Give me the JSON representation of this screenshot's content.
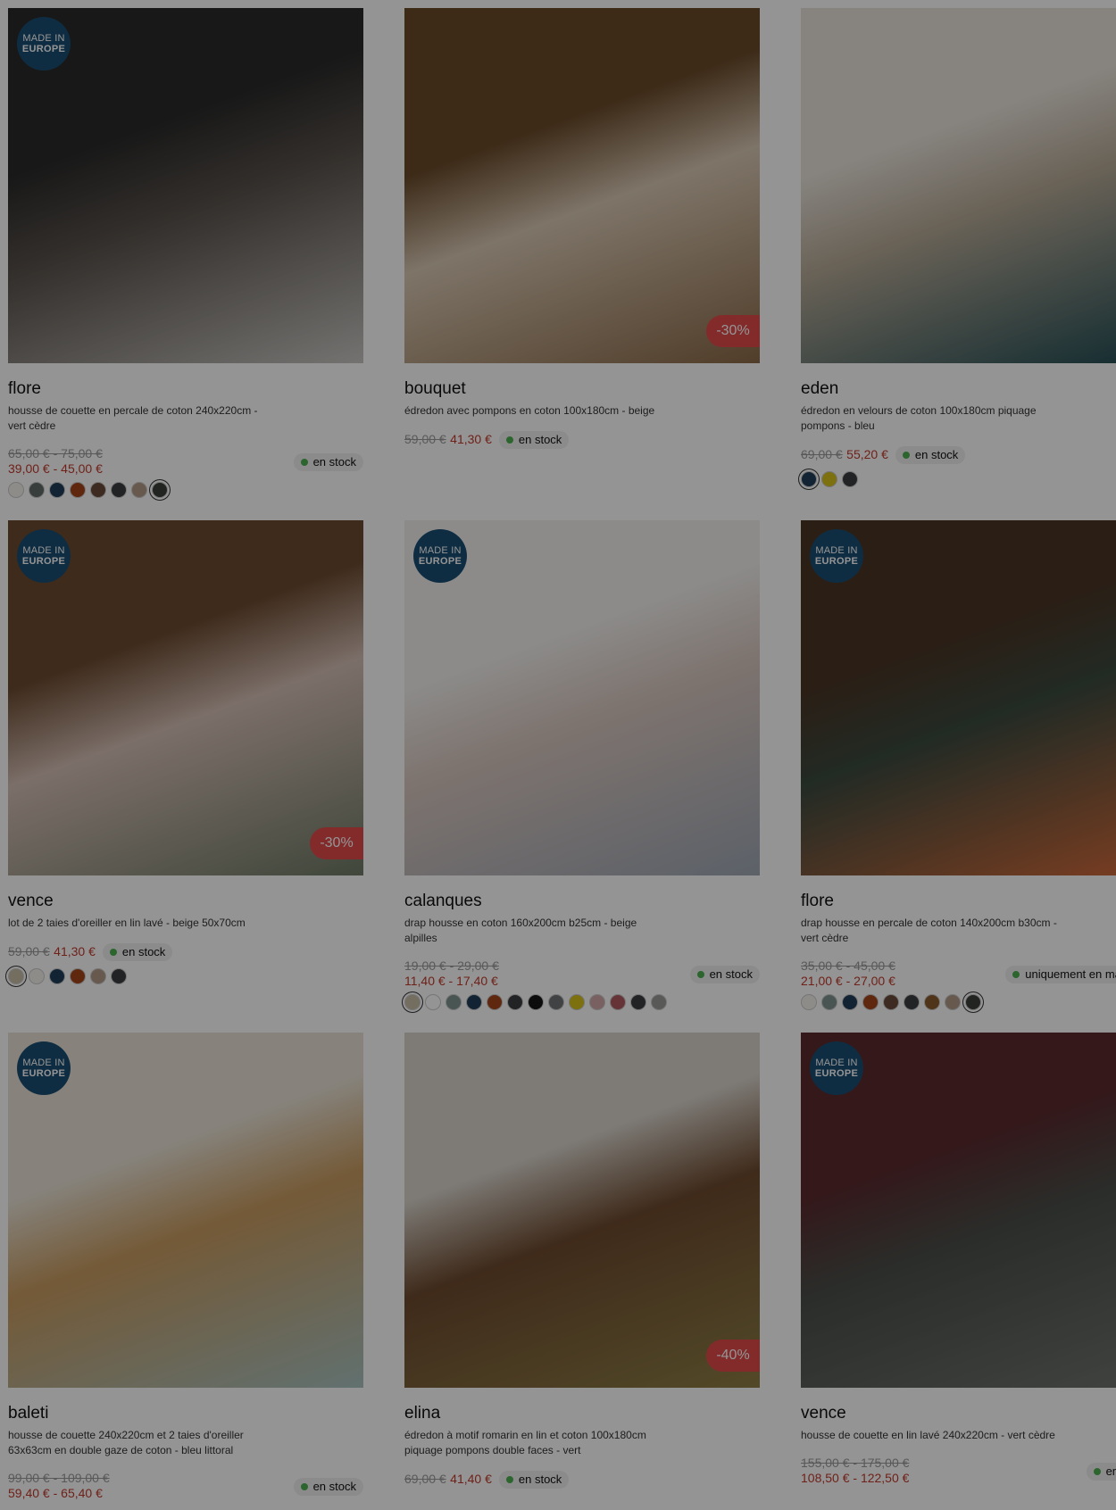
{
  "badge": {
    "line1": "MADE IN",
    "line2": "EUROPE"
  },
  "products": [
    {
      "name": "flore",
      "desc": "housse de couette en percale de coton 240x220cm - vert cèdre",
      "old": "65,00 € - 75,00 €",
      "new": "39,00 € - 45,00 €",
      "stock": "en stock",
      "made_eu": true,
      "discount": "",
      "swatches": [
        "#f4f1ea",
        "#5f6b66",
        "#1f3d5a",
        "#a5441b",
        "#6a4a3a",
        "#3b3d40",
        "#b29986",
        "#3a3f3a"
      ]
    },
    {
      "name": "bouquet",
      "desc": "édredon avec pompons en coton 100x180cm - beige",
      "old": "59,00 €",
      "new": "41,30 €",
      "stock": "en stock",
      "made_eu": false,
      "discount": "-30%",
      "swatches": []
    },
    {
      "name": "eden",
      "desc": "édredon en velours de coton 100x180cm piquage pompons - bleu",
      "old": "69,00 €",
      "new": "55,20 €",
      "stock": "en stock",
      "made_eu": false,
      "discount": "",
      "swatches": [
        "#1f3d5a",
        "#d6c11b",
        "#3b3d40"
      ]
    },
    {
      "name": "vence",
      "desc": "lot de 2 taies d'oreiller en lin lavé - beige 50x70cm",
      "old": "59,00 €",
      "new": "41,30 €",
      "stock": "en stock",
      "made_eu": true,
      "discount": "-30%",
      "swatches": [
        "#c9bda6",
        "#f4f1ea",
        "#1f3d5a",
        "#a5441b",
        "#b29986",
        "#3b3d40"
      ]
    },
    {
      "name": "calanques",
      "desc": "drap housse en coton 160x200cm b25cm - beige alpilles",
      "old": "19,00 € - 29,00 €",
      "new": "11,40 € - 17,40 €",
      "stock": "en stock",
      "made_eu": true,
      "discount": "",
      "swatches": [
        "#c9bda6",
        "#ffffff",
        "#7f938f",
        "#1f3d5a",
        "#a5441b",
        "#3b3d40",
        "#151515",
        "#6f7275",
        "#d6c11b",
        "#d3a7a7",
        "#b05a5f",
        "#3b3d40",
        "#9a9a98"
      ]
    },
    {
      "name": "flore",
      "desc": "drap housse en percale de coton 140x200cm b30cm - vert cèdre",
      "old": "35,00 € - 45,00 €",
      "new": "21,00 € - 27,00 €",
      "stock": "uniquement en magasin",
      "made_eu": true,
      "discount": "",
      "swatches": [
        "#f4f1ea",
        "#7f938f",
        "#1f3d5a",
        "#a5441b",
        "#6a4a3a",
        "#3b3d40",
        "#8a5a2b",
        "#b29986",
        "#3a3f3a"
      ]
    },
    {
      "name": "baleti",
      "desc": "housse de couette 240x220cm et 2 taies d'oreiller 63x63cm en double gaze de coton - bleu littoral",
      "old": "99,00 € - 109,00 €",
      "new": "59,40 € - 65,40 €",
      "stock": "en stock",
      "made_eu": true,
      "discount": "",
      "swatches": []
    },
    {
      "name": "elina",
      "desc": "édredon à motif romarin en lin et coton 100x180cm piquage pompons double faces - vert",
      "old": "69,00 €",
      "new": "41,40 €",
      "stock": "en stock",
      "made_eu": false,
      "discount": "-40%",
      "swatches": []
    },
    {
      "name": "vence",
      "desc": "housse de couette en lin lavé 240x220cm - vert cèdre",
      "old": "155,00 € - 175,00 €",
      "new": "108,50 € - 122,50 €",
      "stock": "en stock",
      "made_eu": true,
      "discount": "",
      "swatches": []
    }
  ],
  "images": [
    {
      "name": "bedroom-dark-wood-bed-image",
      "colors": [
        "#2a2a2a",
        "#58514b",
        "#c8c6c2"
      ]
    },
    {
      "name": "beige-quilt-on-beam-image",
      "colors": [
        "#6a4a2a",
        "#d9c9b4",
        "#8b6a48"
      ]
    },
    {
      "name": "bedroom-blue-velvet-image",
      "colors": [
        "#e9e4dc",
        "#b8ab98",
        "#1f4a52"
      ]
    },
    {
      "name": "linen-bed-pillows-image",
      "colors": [
        "#6b4a30",
        "#d5bfb5",
        "#6f7a66"
      ]
    },
    {
      "name": "fitted-sheet-mattress-image",
      "colors": [
        "#f2f0ee",
        "#d8c7bf",
        "#9fa7b4"
      ]
    },
    {
      "name": "green-sheet-orange-pillow-image",
      "colors": [
        "#4a3424",
        "#3b4a3f",
        "#d56b3a"
      ]
    },
    {
      "name": "rattan-headboard-bed-image",
      "colors": [
        "#e8e2d6",
        "#c89b60",
        "#a9c2c0"
      ]
    },
    {
      "name": "rattan-chair-quilt-image",
      "colors": [
        "#d9d4cc",
        "#6d4a2f",
        "#8f7f46"
      ]
    },
    {
      "name": "red-wall-green-linen-bed-image",
      "colors": [
        "#5a2a2e",
        "#4a4e49",
        "#6f746f"
      ]
    }
  ]
}
